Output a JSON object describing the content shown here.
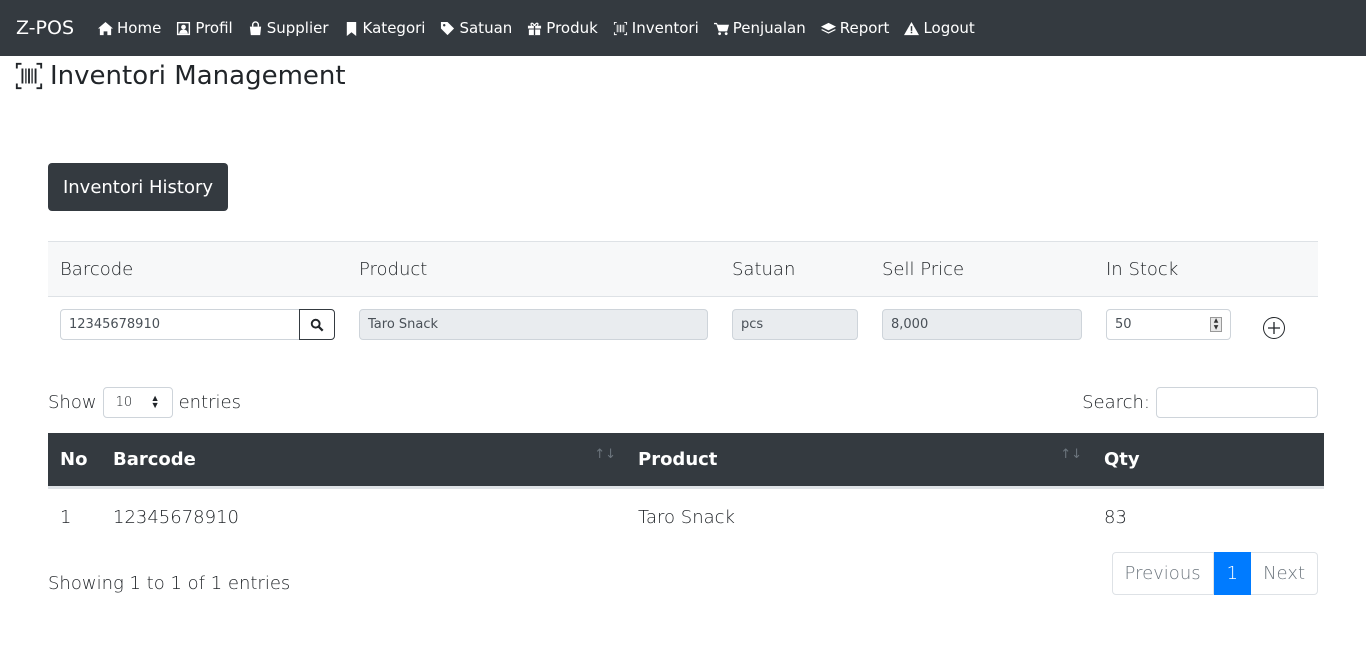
{
  "navbar": {
    "brand": "Z-POS",
    "items": [
      {
        "label": "Home",
        "icon": "home-icon"
      },
      {
        "label": "Profil",
        "icon": "profile-icon"
      },
      {
        "label": "Supplier",
        "icon": "shopping-bag-icon"
      },
      {
        "label": "Kategori",
        "icon": "bookmark-icon"
      },
      {
        "label": "Satuan",
        "icon": "tag-icon"
      },
      {
        "label": "Produk",
        "icon": "gift-icon"
      },
      {
        "label": "Inventori",
        "icon": "barcode-icon"
      },
      {
        "label": "Penjualan",
        "icon": "cart-icon"
      },
      {
        "label": "Report",
        "icon": "layers-icon"
      },
      {
        "label": "Logout",
        "icon": "warning-icon"
      }
    ]
  },
  "page": {
    "title": "Inventori Management",
    "history_button": "Inventori History"
  },
  "form": {
    "headers": {
      "barcode": "Barcode",
      "product": "Product",
      "satuan": "Satuan",
      "sell_price": "Sell Price",
      "in_stock": "In Stock"
    },
    "values": {
      "barcode": "12345678910",
      "product": "Taro Snack",
      "satuan": "pcs",
      "sell_price": "8,000",
      "in_stock": "50"
    }
  },
  "datatable": {
    "show_label": "Show",
    "entries_label": "entries",
    "page_length": "10",
    "search_label": "Search:",
    "search_value": "",
    "columns": [
      "No",
      "Barcode",
      "Product",
      "Qty"
    ],
    "rows": [
      {
        "no": "1",
        "barcode": "12345678910",
        "product": "Taro Snack",
        "qty": "83"
      }
    ],
    "info": "Showing 1 to 1 of 1 entries",
    "pagination": {
      "previous": "Previous",
      "current": "1",
      "next": "Next"
    }
  },
  "colors": {
    "navbar_bg": "#343a40",
    "accent": "#007bff",
    "readonly_bg": "#e9ecef"
  }
}
